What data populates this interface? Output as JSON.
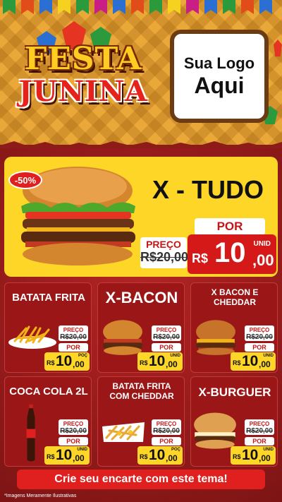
{
  "header": {
    "title_line1": "FESTA",
    "title_line2": "JUNINA",
    "logo_line1": "Sua Logo",
    "logo_line2": "Aqui"
  },
  "featured": {
    "discount": "-50%",
    "name": "X - TUDO",
    "preco_label": "PREÇO",
    "old_price": "R$20,00",
    "por_label": "POR",
    "currency": "R$",
    "price_int": "10",
    "price_cents": ",00",
    "unit": "UNID"
  },
  "products": [
    {
      "name": "BATATA FRITA",
      "preco_label": "PREÇO",
      "old_price": "R$20,00",
      "por_label": "POR",
      "currency": "R$",
      "price_int": "10",
      "price_cents": ",00",
      "unit": "POÇ"
    },
    {
      "name": "X-BACON",
      "preco_label": "PREÇO",
      "old_price": "R$20,00",
      "por_label": "POR",
      "currency": "R$",
      "price_int": "10",
      "price_cents": ",00",
      "unit": "UNID"
    },
    {
      "name": "X BACON E CHEDDAR",
      "preco_label": "PREÇO",
      "old_price": "R$20,00",
      "por_label": "POR",
      "currency": "R$",
      "price_int": "10",
      "price_cents": ",00",
      "unit": "UNID"
    },
    {
      "name": "COCA COLA 2L",
      "preco_label": "PREÇO",
      "old_price": "R$20,00",
      "por_label": "POR",
      "currency": "R$",
      "price_int": "10",
      "price_cents": ",00",
      "unit": "UNID"
    },
    {
      "name": "BATATA FRITA COM CHEDDAR",
      "preco_label": "PREÇO",
      "old_price": "R$20,00",
      "por_label": "POR",
      "currency": "R$",
      "price_int": "10",
      "price_cents": ",00",
      "unit": "POÇ"
    },
    {
      "name": "X-BURGUER",
      "preco_label": "PREÇO",
      "old_price": "R$20,00",
      "por_label": "POR",
      "currency": "R$",
      "price_int": "10",
      "price_cents": ",00",
      "unit": "UNID"
    }
  ],
  "cta": "Crie seu encarte com este tema!",
  "footnote": "*Imagens Meramente Ilustrativas",
  "colors": {
    "background_red": "#8e1a1a",
    "header_yellow": "#e9a838",
    "featured_yellow": "#fdd628",
    "price_red": "#d51919"
  },
  "icons": [
    "bunting-flags",
    "balloon-lantern",
    "x-tudo-burger",
    "fries",
    "x-bacon-burger",
    "bacon-cheddar-burger",
    "coca-cola-bottle",
    "cheddar-fries",
    "x-burguer-burger"
  ]
}
